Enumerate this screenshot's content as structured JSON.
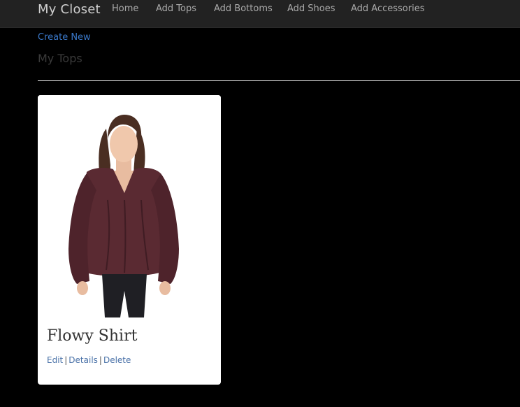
{
  "navbar": {
    "brand": "My Closet",
    "items": [
      {
        "label": "Home"
      },
      {
        "label": "Add Tops"
      },
      {
        "label": "Add Bottoms"
      },
      {
        "label": "Add Shoes"
      },
      {
        "label": "Add Accessories"
      }
    ]
  },
  "page": {
    "create_new": "Create New",
    "title": "My Tops"
  },
  "items": [
    {
      "title": "Flowy Shirt",
      "image_desc": "woman wearing maroon flowy long-sleeve blouse",
      "actions": {
        "edit": "Edit",
        "details": "Details",
        "delete": "Delete",
        "separator": "|"
      }
    }
  ],
  "colors": {
    "background": "#000000",
    "navbar": "#222222",
    "link": "#3a78c9",
    "card": "#ffffff",
    "shirt": "#5a2a32"
  }
}
